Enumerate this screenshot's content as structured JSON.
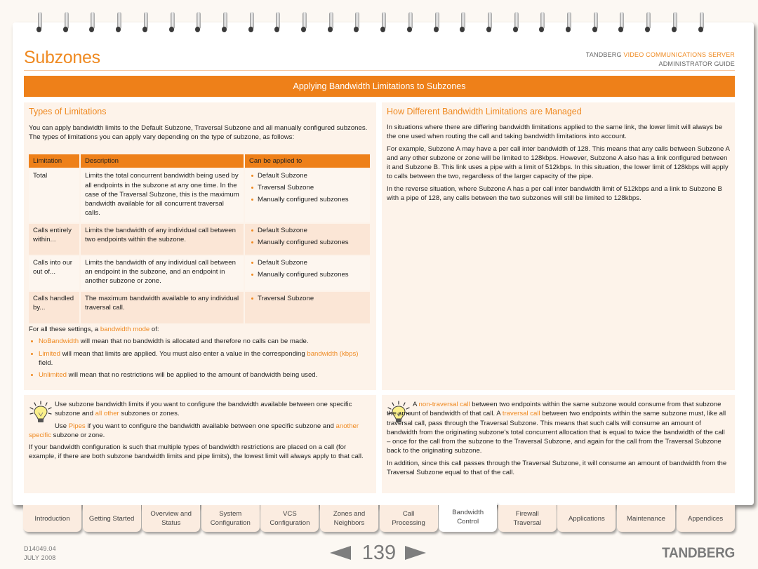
{
  "header": {
    "title": "Subzones",
    "brand_prefix": "TANDBERG",
    "brand_product": "VIDEO COMMUNICATIONS SERVER",
    "brand_subtitle": "ADMINISTRATOR GUIDE"
  },
  "section_banner": "Applying Bandwidth Limitations to Subzones",
  "left_panel": {
    "heading": "Types of Limitations",
    "intro": "You can apply bandwidth limits to the Default Subzone, Traversal Subzone and all manually configured subzones.  The types of limitations you can apply vary depending on the type of subzone, as follows:",
    "table": {
      "headers": [
        "Limitation",
        "Description",
        "Can be applied to"
      ],
      "rows": [
        {
          "limitation": "Total",
          "description": "Limits the total concurrent bandwidth being used by all endpoints in the subzone at any one time.  In the case of the Traversal Subzone, this is the maximum bandwidth available for all concurrent traversal calls.",
          "applies_to": [
            "Default Subzone",
            "Traversal Subzone",
            "Manually configured subzones"
          ]
        },
        {
          "limitation": "Calls entirely within...",
          "description": "Limits the bandwidth of any individual call between two endpoints within the subzone.",
          "applies_to": [
            "Default Subzone",
            "Manually configured subzones"
          ]
        },
        {
          "limitation": "Calls into our out of...",
          "description": "Limits the bandwidth of any individual call between an endpoint in the subzone, and an endpoint in another subzone or zone.",
          "applies_to": [
            "Default Subzone",
            "Manually configured subzones"
          ]
        },
        {
          "limitation": "Calls handled by...",
          "description": "The maximum bandwidth available to any individual traversal call.",
          "applies_to": [
            "Traversal Subzone"
          ]
        }
      ]
    },
    "modes_intro_before": "For all these settings, a ",
    "modes_intro_link": "bandwidth mode",
    "modes_intro_after": " of:",
    "modes": [
      {
        "name": "NoBandwidth",
        "text": " will mean that no bandwidth is allocated and therefore no calls can be made."
      },
      {
        "name": "Limited",
        "text": " will mean that limits are applied.  You must also enter a value in the corresponding ",
        "link": "bandwidth (kbps)",
        "text_after": " field."
      },
      {
        "name": "Unlimited",
        "text": " will mean that no restrictions will be applied to the amount of bandwidth being used."
      }
    ]
  },
  "right_panel": {
    "heading": "How Different Bandwidth Limitations are Managed",
    "paragraphs": [
      "In situations where there are differing bandwidth limitations applied to the same link, the lower limit will always be the one used when routing the call and taking bandwidth limitations into account.",
      "For example, Subzone A may have a per call inter bandwidth of 128.  This means that any calls between Subzone A and any other subzone or zone will be limited to 128kbps.  However, Subzone A also has a link configured between it and Subzone B.  This link uses a pipe with a limit of 512kbps.  In this situation, the lower limit of 128kbps will apply to calls between the two, regardless of the larger capacity of the pipe.",
      "In the reverse situation, where Subzone A has a per call inter bandwidth limit of 512kbps and a link to Subzone B with a pipe of 128, any calls between the two subzones will still be limited to 128kbps."
    ]
  },
  "tip_left": {
    "icon": "lightbulb-icon",
    "p1_before": "Use subzone bandwidth limits if you want to configure the bandwidth available between one specific subzone and ",
    "p1_link": "all other",
    "p1_after": " subzones or zones.",
    "p2_before": "Use ",
    "p2_link1": "Pipes",
    "p2_mid": " if you want to configure the bandwidth available between one specific subzone and ",
    "p2_link2": "another specific",
    "p2_after": " subzone or zone.",
    "p3": "If your bandwidth configuration is such that multiple types of bandwidth restrictions are placed on a call (for example, if there are both subzone bandwidth limits and pipe limits), the lowest limit will always apply to that call."
  },
  "tip_right": {
    "icon": "lightbulb-icon",
    "p1_before": "A ",
    "p1_link1": "non-traversal call",
    "p1_mid": " between two endpoints within the same subzone would consume from that subzone the amount of bandwidth of that call.  A ",
    "p1_link2": "traversal call",
    "p1_after": " between two endpoints within the same subzone must, like all traversal call, pass through the Traversal Subzone. This means that such calls will consume an amount of bandwidth from the originating subzone's total concurrent allocation that is equal to twice the bandwidth of the call – once for the call from the subzone to the Traversal Subzone, and again for the call from the Traversal Subzone back to the originating subzone.",
    "p2": "In addition, since this call passes through the Traversal Subzone, it will consume an amount of bandwidth from the Traversal Subzone equal to that of the call."
  },
  "tabs": [
    {
      "line1": "Introduction",
      "line2": "",
      "active": false
    },
    {
      "line1": "Getting Started",
      "line2": "",
      "active": false
    },
    {
      "line1": "Overview and",
      "line2": "Status",
      "active": false
    },
    {
      "line1": "System",
      "line2": "Configuration",
      "active": false
    },
    {
      "line1": "VCS",
      "line2": "Configuration",
      "active": false
    },
    {
      "line1": "Zones and",
      "line2": "Neighbors",
      "active": false
    },
    {
      "line1": "Call",
      "line2": "Processing",
      "active": false
    },
    {
      "line1": "Bandwidth",
      "line2": "Control",
      "active": true
    },
    {
      "line1": "Firewall",
      "line2": "Traversal",
      "active": false
    },
    {
      "line1": "Applications",
      "line2": "",
      "active": false
    },
    {
      "line1": "Maintenance",
      "line2": "",
      "active": false
    },
    {
      "line1": "Appendices",
      "line2": "",
      "active": false
    }
  ],
  "footer": {
    "doc_number": "D14049.04",
    "date": "JULY 2008",
    "page_number": "139",
    "logo": "TANDBERG"
  },
  "colors": {
    "accent": "#ee8019",
    "link": "#ef8a22",
    "panel_bg": "#fdf3ea"
  }
}
